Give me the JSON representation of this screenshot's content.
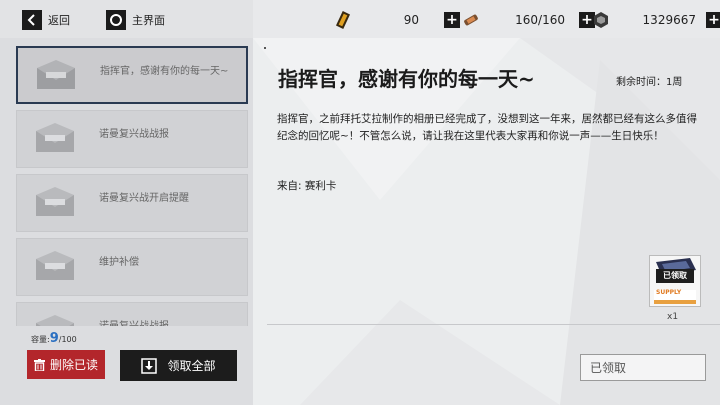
{
  "topbar": {
    "back_label": "返回",
    "home_label": "主界面",
    "resources": [
      {
        "icon": "ammo-icon",
        "value": "90"
      },
      {
        "icon": "ration-icon",
        "value": "160/160"
      },
      {
        "icon": "core-icon",
        "value": "1329667"
      }
    ],
    "plus_label": "+"
  },
  "mail_list": {
    "items": [
      {
        "title": "指挥官，感谢有你的每一天~",
        "selected": true
      },
      {
        "title": "诺曼复兴战战报",
        "selected": false
      },
      {
        "title": "诺曼复兴战开启提醒",
        "selected": false
      },
      {
        "title": "维护补偿",
        "selected": false
      },
      {
        "title": "诺曼复兴战战报",
        "selected": false
      }
    ]
  },
  "capacity": {
    "label": "容量:",
    "current": "9",
    "max": "/100"
  },
  "buttons": {
    "delete_read": "删除已读",
    "claim_all": "领取全部",
    "claimed": "已领取"
  },
  "mail_detail": {
    "title": "指挥官，感谢有你的每一天~",
    "remaining": "剩余时间：1周",
    "body": "指挥官，之前拜托艾拉制作的相册已经完成了，没想到这一年来，居然都已经有这么多值得纪念的回忆呢~！不管怎么说，请让我在这里代表大家再和你说一声——生日快乐！",
    "sender": "来自: 赛利卡",
    "attachment": {
      "tag": "已领取",
      "caption": "SUPPLY",
      "quantity": "x1",
      "icon": "supply-crate-icon"
    }
  },
  "colors": {
    "delete": "#b3262b",
    "dark": "#1c1c1c",
    "accent": "#2a6fc1"
  }
}
